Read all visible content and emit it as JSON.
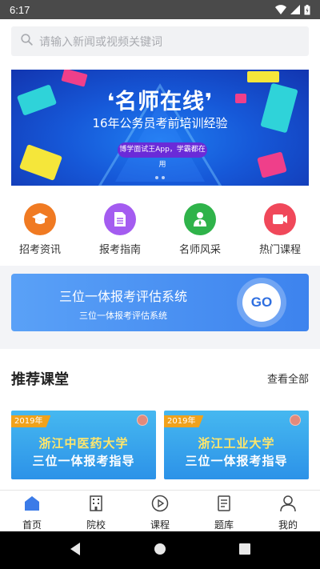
{
  "status_bar": {
    "time": "6:17"
  },
  "search": {
    "placeholder": "请输入新闻或视频关键词"
  },
  "banner": {
    "title": "❛名师在线❜",
    "subtitle": "16年公务员考前培训经验",
    "pill": "博学面试王App，学霸都在用"
  },
  "quick_menu": [
    {
      "label": "招考资讯",
      "icon": "graduation-cap-icon",
      "color": "#f07a22"
    },
    {
      "label": "报考指南",
      "icon": "document-icon",
      "color": "#a45cf0"
    },
    {
      "label": "名师风采",
      "icon": "teacher-icon",
      "color": "#2fb34a"
    },
    {
      "label": "热门课程",
      "icon": "video-icon",
      "color": "#f0485a"
    }
  ],
  "promo": {
    "title": "三位一体报考评估系统",
    "subtitle": "三位一体报考评估系统",
    "go_label": "GO"
  },
  "section": {
    "title": "推荐课堂",
    "more": "查看全部"
  },
  "courses": [
    {
      "tag": "2019年",
      "line1": "浙江中医药大学",
      "line2": "三位一体报考指导"
    },
    {
      "tag": "2019年",
      "line1": "浙江工业大学",
      "line2": "三位一体报考指导"
    }
  ],
  "tabs": [
    {
      "label": "首页",
      "icon": "home-icon",
      "active": true
    },
    {
      "label": "院校",
      "icon": "building-icon",
      "active": false
    },
    {
      "label": "课程",
      "icon": "play-icon",
      "active": false
    },
    {
      "label": "题库",
      "icon": "question-bank-icon",
      "active": false
    },
    {
      "label": "我的",
      "icon": "profile-icon",
      "active": false
    }
  ],
  "colors": {
    "accent": "#2f6fe0",
    "tab_active": "#3b7be8"
  }
}
